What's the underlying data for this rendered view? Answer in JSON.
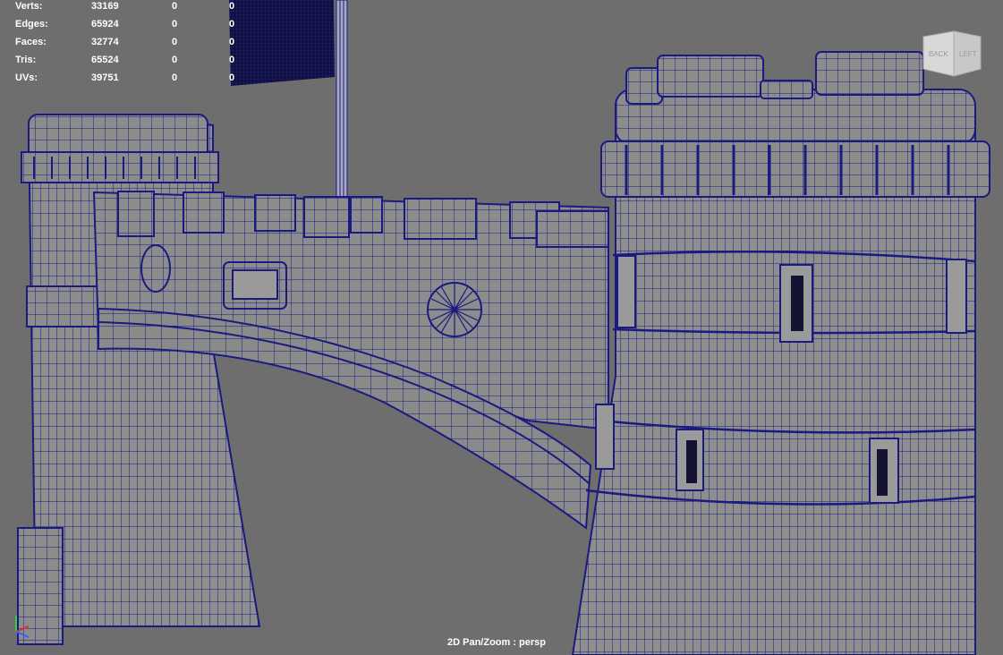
{
  "hud": {
    "rows": [
      {
        "label": "Verts:",
        "v1": "33169",
        "v2": "0",
        "v3": "0"
      },
      {
        "label": "Edges:",
        "v1": "65924",
        "v2": "0",
        "v3": "0"
      },
      {
        "label": "Faces:",
        "v1": "32774",
        "v2": "0",
        "v3": "0"
      },
      {
        "label": "Tris:",
        "v1": "65524",
        "v2": "0",
        "v3": "0"
      },
      {
        "label": "UVs:",
        "v1": "39751",
        "v2": "0",
        "v3": "0"
      }
    ]
  },
  "camera_label": "2D Pan/Zoom : persp",
  "viewcube": {
    "back_label": "BACK",
    "left_label": "LEFT"
  },
  "colors": {
    "background": "#6e6e6e",
    "surface": "#8a8a8a",
    "wire": "#16167a",
    "hud_text": "#ffffff"
  }
}
